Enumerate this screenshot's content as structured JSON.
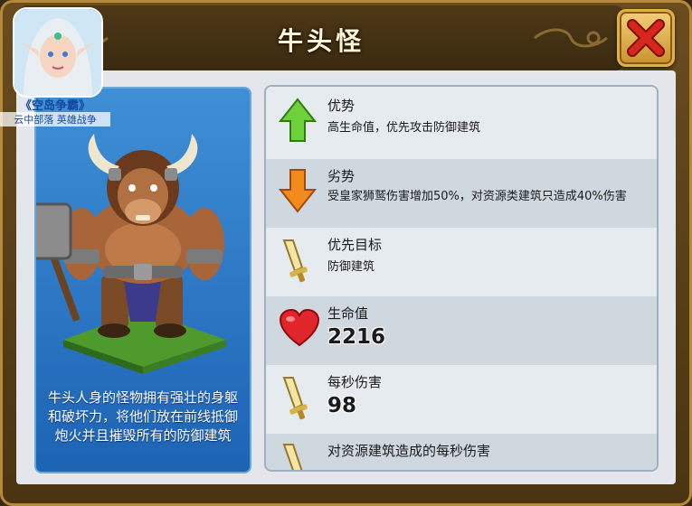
{
  "window": {
    "title": "牛头怪"
  },
  "logo": {
    "game_name": "《空岛争霸》",
    "tagline": "云中部落 英雄战争"
  },
  "hero": {
    "description": "牛头人身的怪物拥有强壮的身躯和破坏力，将他们放在前线抵御炮火并且摧毁所有的防御建筑"
  },
  "stats": {
    "advantage": {
      "label": "优势",
      "text": "高生命值，优先攻击防御建筑",
      "icon": "green-up-arrow-icon"
    },
    "disadvantage": {
      "label": "劣势",
      "text": "受皇家狮鹫伤害增加50%，对资源类建筑只造成40%伤害",
      "icon": "orange-down-arrow-icon"
    },
    "target": {
      "label": "优先目标",
      "text": "防御建筑",
      "icon": "sword-icon"
    },
    "hp": {
      "label": "生命值",
      "value": "2216",
      "icon": "heart-icon"
    },
    "dps": {
      "label": "每秒伤害",
      "value": "98",
      "icon": "sword-icon"
    },
    "resource_dps": {
      "label": "对资源建筑造成的每秒伤害",
      "icon": "sword-icon"
    }
  },
  "colors": {
    "frame": "#6a4c1e",
    "panel_blue": "#2a78c8",
    "close_red": "#c8221a"
  }
}
